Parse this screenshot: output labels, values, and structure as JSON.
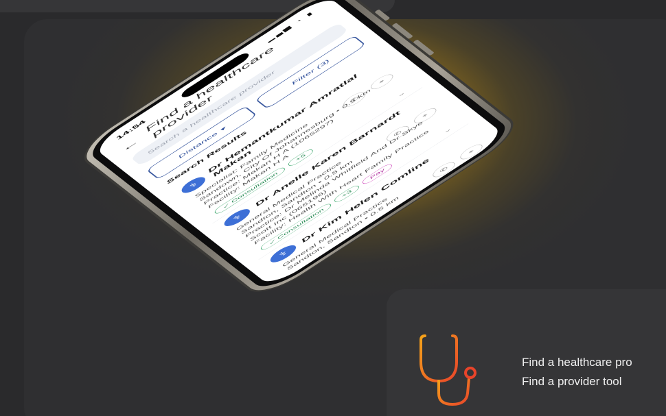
{
  "phone": {
    "status_time": "14:54",
    "app_title": "Find a healthcare provider",
    "search_placeholder": "Search a healthcare provider",
    "filters": {
      "distance": "Distance ▾",
      "filter": "Filter (3)"
    },
    "results_heading": "Search Results",
    "results": [
      {
        "name": "Dr Hemantkumar Amratlal Makan",
        "line1": "Specialist: Family Medicine",
        "line2": "Sandown, City Of Johannesburg • 0.5 km",
        "line3": "Practice: Makan H A (1065297)",
        "line4": "Facility: Makan H A",
        "chips": [
          "✓ Consultation",
          "+5"
        ]
      },
      {
        "name": "Dr Anelle Karen Barnardt",
        "line1": "General Medical Practice",
        "line2": "Sandton, Sandton • 0.5 km",
        "line3": "Practice: Dr Melinda Whitfield And Dr Skye Scott Inc (065196)",
        "line4": "Facility: Health With Heart Family Practice",
        "chips": [
          "✓ Consultation",
          "+3"
        ],
        "pink_chip": "Pay"
      },
      {
        "name": "Dr Kim Helen Comline",
        "line1": "General Medical Practice",
        "line2": "Sandton, Sandton • 0.5 km"
      }
    ]
  },
  "info": {
    "line1": "Find a healthcare pro",
    "line2": "Find a provider tool"
  },
  "colors": {
    "accent_blue": "#3d6fd6",
    "chip_green": "#3aa66a",
    "icon_gradient_start": "#f5a31a",
    "icon_gradient_end": "#e8442a"
  }
}
